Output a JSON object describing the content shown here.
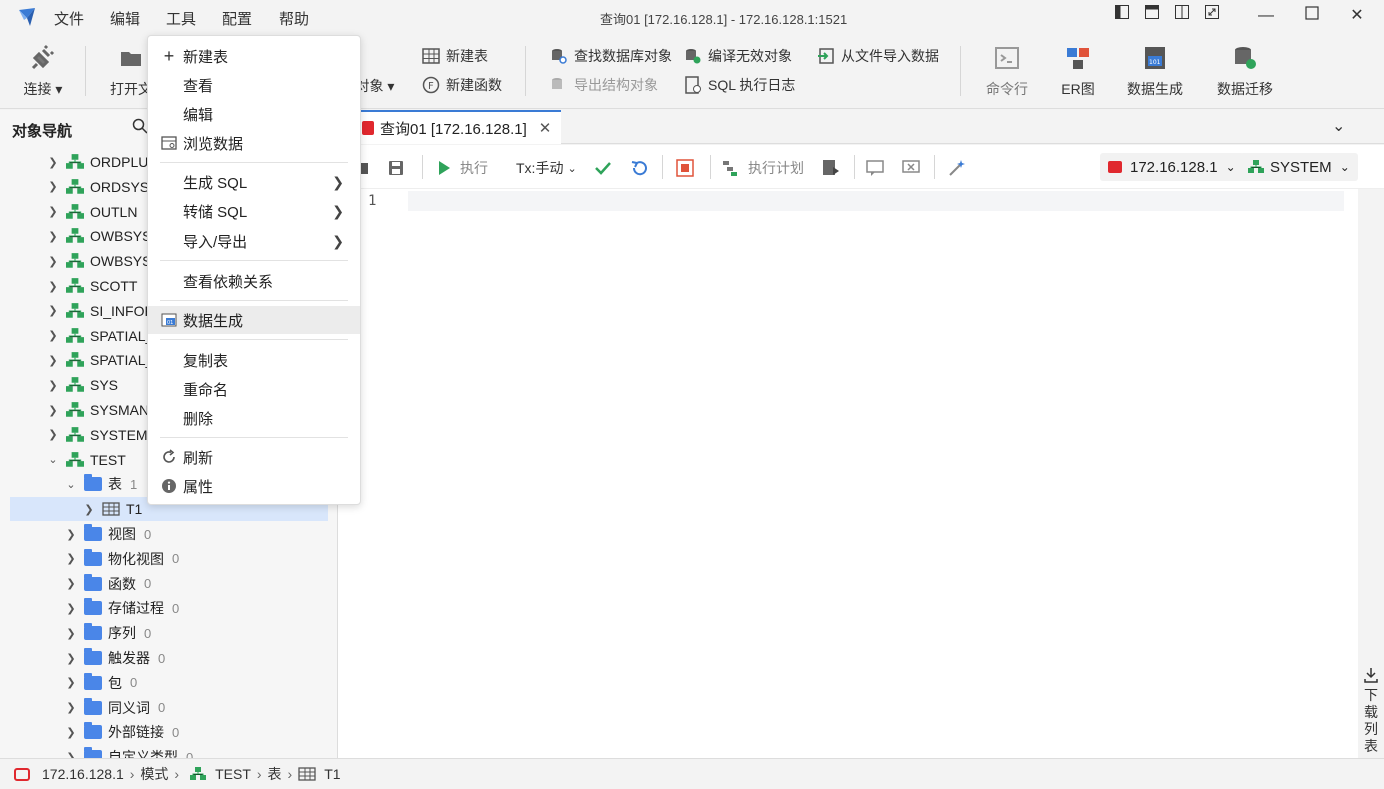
{
  "app": {
    "menu": [
      "文件",
      "编辑",
      "工具",
      "配置",
      "帮助"
    ],
    "window_title": "查询01 [172.16.128.1]  - 172.16.128.1:1521"
  },
  "toolbar": {
    "connect": "连接",
    "open": "打开文",
    "objects": "对象",
    "new_table": "新建表",
    "new_function": "新建函数",
    "find_db_objects": "查找数据库对象",
    "export_struct": "导出结构对象",
    "compile_invalid": "编译无效对象",
    "sql_log": "SQL 执行日志",
    "import_from_file": "从文件导入数据",
    "cmdline": "命令行",
    "er": "ER图",
    "datagen": "数据生成",
    "migrate": "数据迁移"
  },
  "nav": {
    "title": "对象导航",
    "schemas": [
      "ORDPLUG",
      "ORDSYS",
      "OUTLN",
      "OWBSYS",
      "OWBSYS_",
      "SCOTT",
      "SI_INFOR",
      "SPATIAL_",
      "SPATIAL_",
      "SYS",
      "SYSMAN",
      "SYSTEM",
      "TEST"
    ],
    "test_children": [
      {
        "label": "表",
        "count": "1"
      },
      {
        "label": "视图",
        "count": "0"
      },
      {
        "label": "物化视图",
        "count": "0"
      },
      {
        "label": "函数",
        "count": "0"
      },
      {
        "label": "存储过程",
        "count": "0"
      },
      {
        "label": "序列",
        "count": "0"
      },
      {
        "label": "触发器",
        "count": "0"
      },
      {
        "label": "包",
        "count": "0"
      },
      {
        "label": "同义词",
        "count": "0"
      },
      {
        "label": "外部链接",
        "count": "0"
      },
      {
        "label": "自定义类型",
        "count": "0"
      }
    ],
    "table_item": "T1"
  },
  "tab": {
    "label": "查询01 [172.16.128.1]"
  },
  "editor_toolbar": {
    "run": "执行",
    "tx": "Tx:手动",
    "plan": "执行计划",
    "connection": "172.16.128.1",
    "schema": "SYSTEM"
  },
  "editor": {
    "line_number": "1"
  },
  "right_strip": {
    "download_list": "下载列表"
  },
  "statusbar": {
    "conn": "172.16.128.1",
    "mode": "模式",
    "schema": "TEST",
    "kind": "表",
    "table": "T1"
  },
  "context_menu": {
    "new_table": "新建表",
    "view": "查看",
    "edit": "编辑",
    "browse": "浏览数据",
    "gen_sql": "生成 SQL",
    "dump_sql": "转储 SQL",
    "import_export": "导入/导出",
    "dependencies": "查看依赖关系",
    "datagen": "数据生成",
    "copy": "复制表",
    "rename": "重命名",
    "delete": "删除",
    "refresh": "刷新",
    "properties": "属性"
  },
  "colors": {
    "accent": "#3a7bd5",
    "schema_green": "#2fa35a",
    "folder_blue": "#4a86e8",
    "oracle_red": "#e0282e"
  }
}
